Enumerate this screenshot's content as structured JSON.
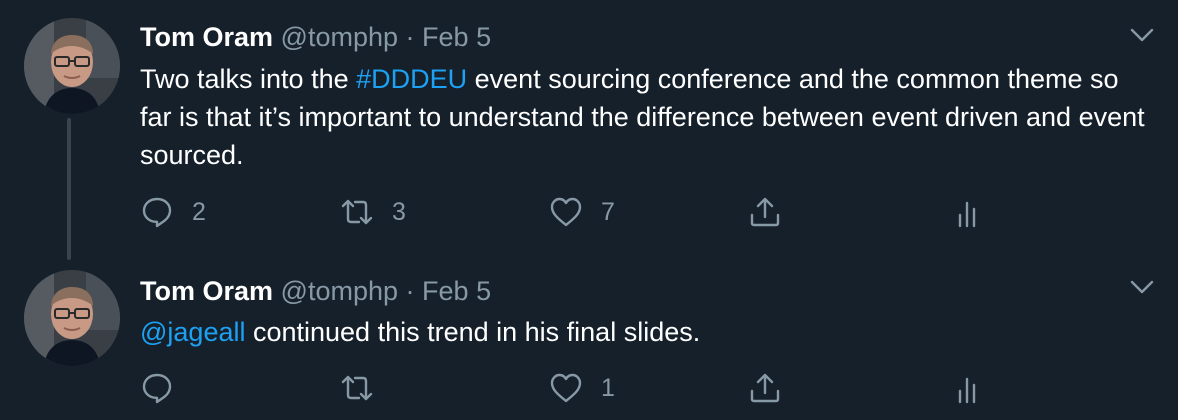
{
  "tweets": [
    {
      "name": "Tom Oram",
      "handle": "@tomphp",
      "separator": "·",
      "date": "Feb 5",
      "text_before": "Two talks into the ",
      "hashtag": "#DDDEU",
      "text_after": " event sourcing conference and the common theme so far is that it’s important to understand the difference between event driven and event sourced.",
      "reply_count": "2",
      "retweet_count": "3",
      "like_count": "7"
    },
    {
      "name": "Tom Oram",
      "handle": "@tomphp",
      "separator": "·",
      "date": "Feb 5",
      "mention": "@jageall",
      "text_after": " continued this trend in his final slides.",
      "reply_count": "",
      "retweet_count": "",
      "like_count": "1"
    }
  ],
  "colors": {
    "background": "#15202b",
    "secondary_text": "#8899a6",
    "link": "#1da1f2",
    "thread_line": "#38444d"
  },
  "icons": [
    "reply-icon",
    "retweet-icon",
    "like-icon",
    "share-icon",
    "analytics-icon",
    "chevron-down-icon"
  ]
}
